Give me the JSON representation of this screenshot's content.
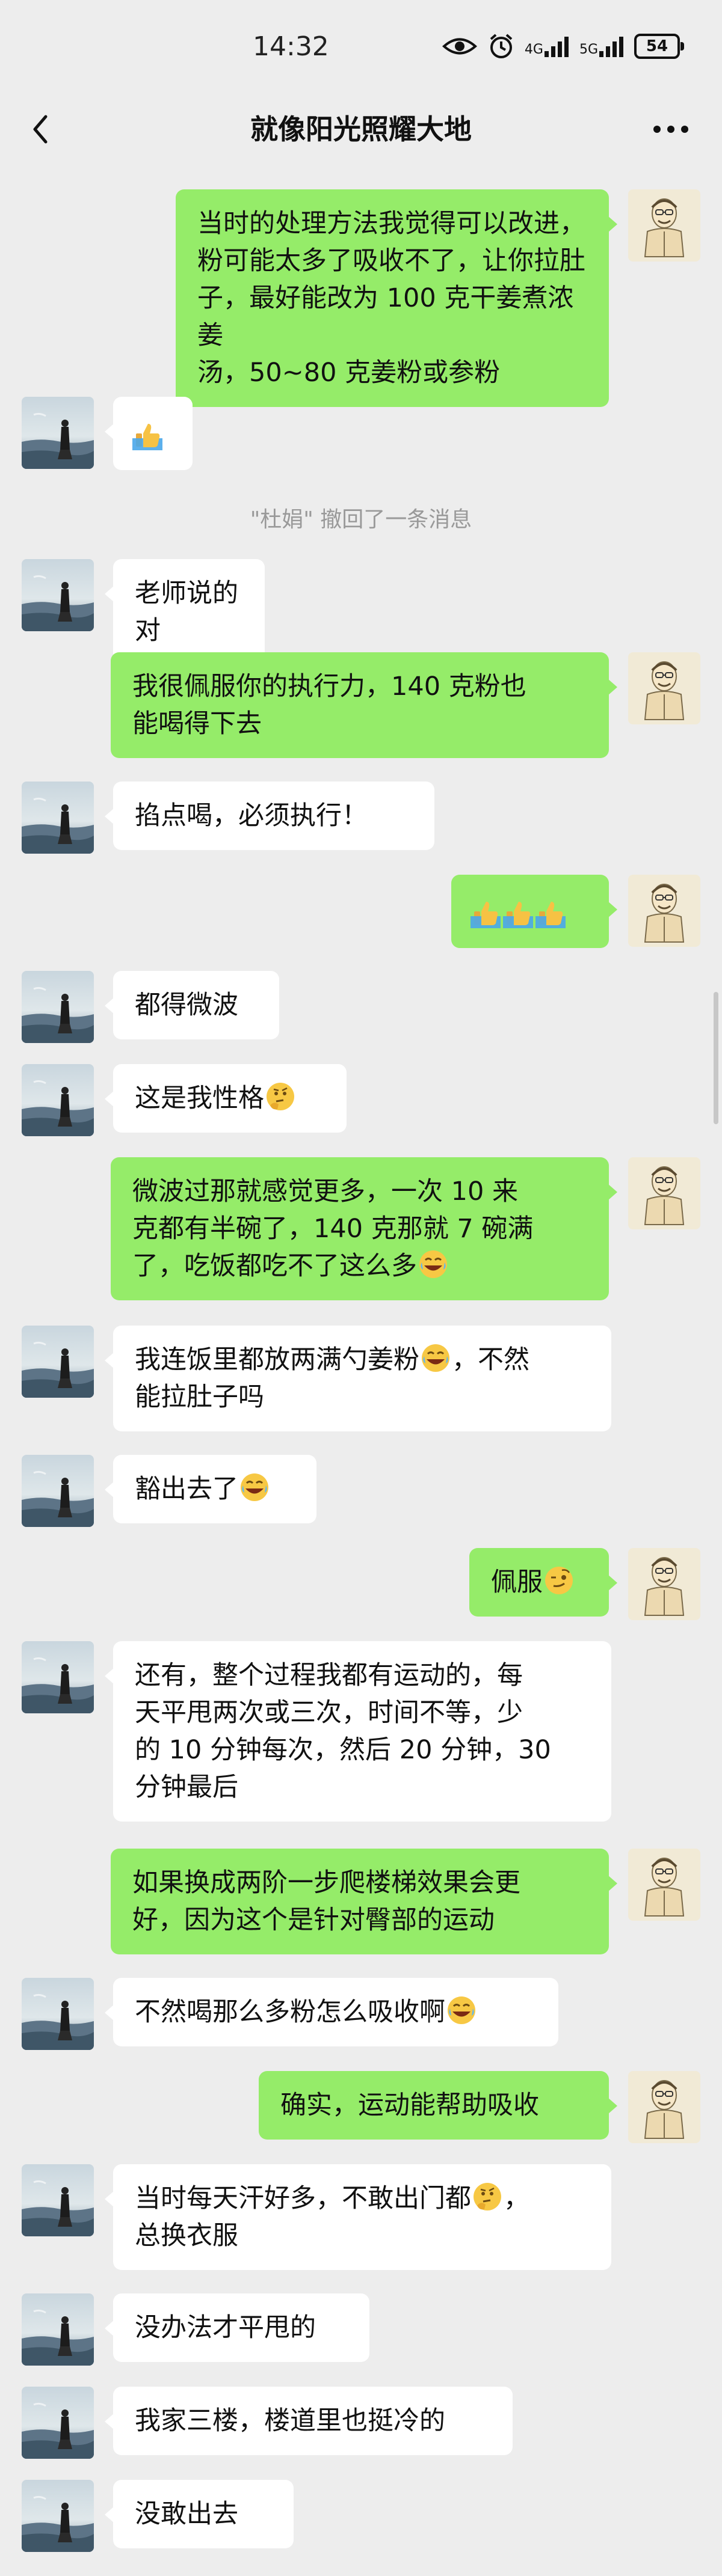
{
  "status_bar": {
    "time": "14:32",
    "net1": "4G",
    "net2": "5G",
    "battery": "54"
  },
  "nav": {
    "title": "就像阳光照耀大地"
  },
  "messages": [
    {
      "side": "out",
      "lines": [
        "当时的处理方法我觉得可以改进，",
        "粉可能太多了吸收不了，让你拉肚",
        "子，最好能改为 100 克干姜煮浓姜",
        "汤，50~80 克姜粉或参粉"
      ]
    },
    {
      "side": "in",
      "emoji_only": "thumbs-up"
    },
    {
      "recall_text": "\"杜娟\" 撤回了一条消息"
    },
    {
      "side": "in",
      "lines": [
        "老师说的对"
      ]
    },
    {
      "side": "out",
      "lines": [
        "我很佩服你的执行力，140 克粉也",
        "能喝得下去"
      ]
    },
    {
      "side": "in",
      "lines": [
        "掐点喝，必须执行！"
      ]
    },
    {
      "side": "out",
      "emoji_only": "three-thumbs-up"
    },
    {
      "side": "in",
      "lines": [
        "都得微波"
      ]
    },
    {
      "side": "in",
      "lines": [
        "这是我性格"
      ],
      "emoji": "thinking-face"
    },
    {
      "side": "out",
      "lines": [
        "微波过那就感觉更多，一次 10 来",
        "克都有半碗了，140 克那就 7 碗满",
        "了，吃饭都吃不了这么多"
      ],
      "emoji": "laughing-face"
    },
    {
      "side": "in",
      "lines": [
        "我连饭里都放两满勺姜粉",
        "能拉肚子吗"
      ],
      "emoji": "laughing-face",
      "suffix": "，不然"
    },
    {
      "side": "in",
      "lines": [
        "豁出去了"
      ],
      "emoji": "laughing-face"
    },
    {
      "side": "out",
      "lines": [
        "佩服"
      ],
      "emoji": "smirk-face"
    },
    {
      "side": "in",
      "lines": [
        "还有，整个过程我都有运动的，每",
        "天平甩两次或三次，时间不等，少",
        "的 10 分钟每次，然后 20 分钟，30",
        "分钟最后"
      ]
    },
    {
      "side": "out",
      "lines": [
        "如果换成两阶一步爬楼梯效果会更",
        "好，因为这个是针对臀部的运动"
      ]
    },
    {
      "side": "in",
      "lines": [
        "不然喝那么多粉怎么吸收啊"
      ],
      "emoji": "laughing-face"
    },
    {
      "side": "out",
      "lines": [
        "确实，运动能帮助吸收"
      ]
    },
    {
      "side": "in",
      "lines": [
        "当时每天汗好多，不敢出门都",
        "总换衣服"
      ],
      "emoji": "thinking-face",
      "suffix": "，"
    },
    {
      "side": "in",
      "lines": [
        "没办法才平甩的"
      ]
    },
    {
      "side": "in",
      "lines": [
        "我家三楼，楼道里也挺冷的"
      ]
    },
    {
      "side": "in",
      "lines": [
        "没敢出去"
      ]
    }
  ]
}
